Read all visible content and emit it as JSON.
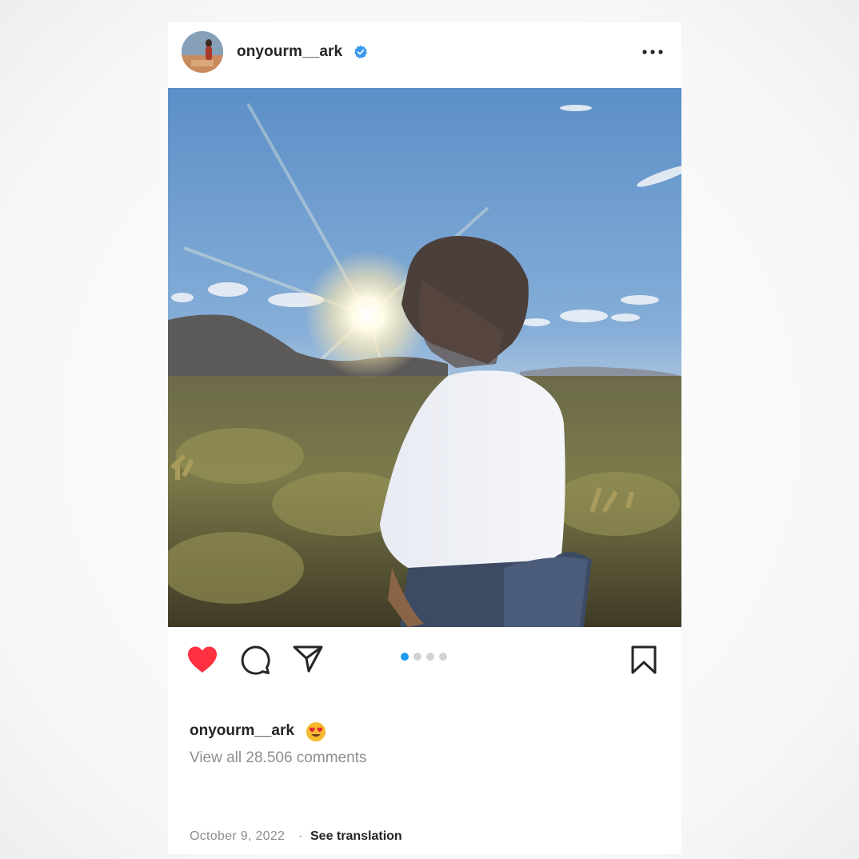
{
  "post": {
    "username": "onyourm__ark",
    "verified": true,
    "menu_icon": "more-horizontal-icon",
    "liked": true,
    "carousel": {
      "total": 4,
      "current": 1
    },
    "caption_username": "onyourm__ark",
    "caption_emoji": "😍",
    "view_comments": "View all 28.506 comments",
    "date": "October 9, 2022",
    "separator": "·",
    "see_translation": "See translation"
  },
  "colors": {
    "like_red": "#ff3040",
    "carousel_active": "#1d9bf0",
    "verified_blue": "#3897f0",
    "text_primary": "#262626",
    "text_secondary": "#8e8e8e"
  },
  "icons": [
    "heart-icon",
    "comment-icon",
    "share-icon",
    "bookmark-icon",
    "verified-badge-icon",
    "more-horizontal-icon"
  ]
}
